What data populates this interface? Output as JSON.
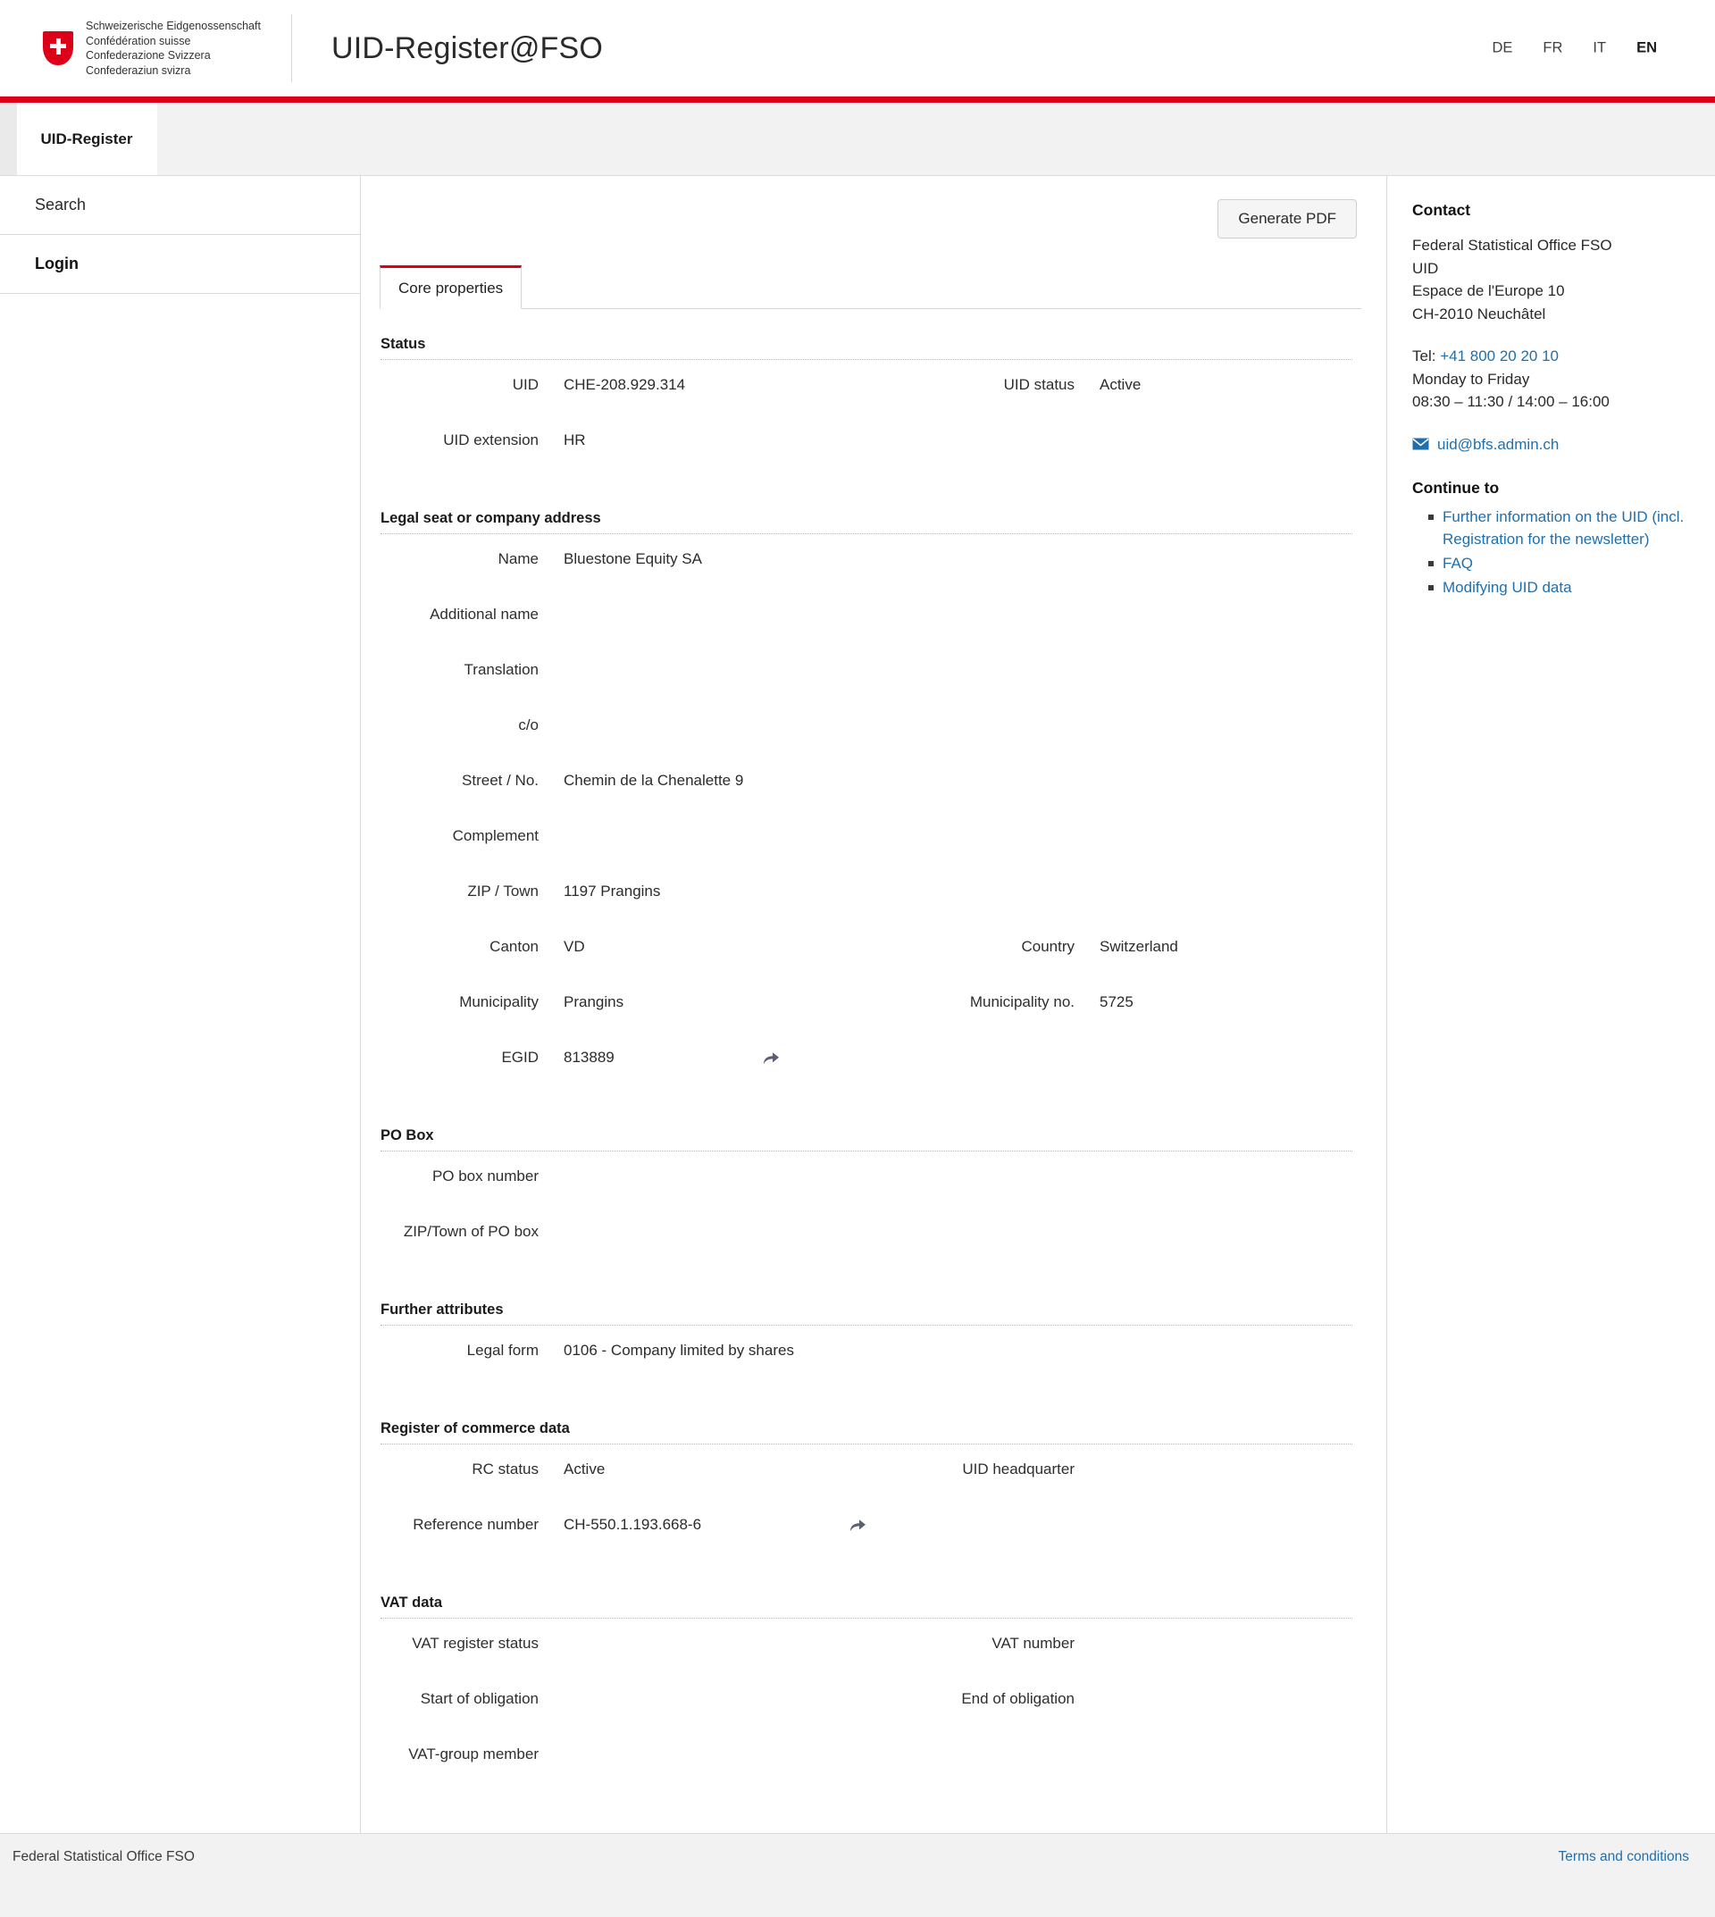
{
  "header": {
    "confederation_lines": [
      "Schweizerische Eidgenossenschaft",
      "Confédération suisse",
      "Confederazione Svizzera",
      "Confederaziun svizra"
    ],
    "app_title": "UID-Register@FSO",
    "languages": [
      {
        "code": "DE",
        "active": false
      },
      {
        "code": "FR",
        "active": false
      },
      {
        "code": "IT",
        "active": false
      },
      {
        "code": "EN",
        "active": true
      }
    ]
  },
  "tabstrip": {
    "main_tab": "UID-Register"
  },
  "sidebar": {
    "items": [
      {
        "label": "Search",
        "bold": false
      },
      {
        "label": "Login",
        "bold": true
      }
    ]
  },
  "main": {
    "generate_pdf_label": "Generate PDF",
    "active_tab": "Core properties",
    "sections": [
      {
        "title": "Status",
        "rows": [
          {
            "left": {
              "label": "UID",
              "value": "CHE-208.929.314"
            },
            "right": {
              "label": "UID status",
              "value": "Active"
            }
          },
          {
            "left": {
              "label": "UID extension",
              "value": "HR"
            },
            "right": {
              "label": "",
              "value": ""
            }
          }
        ]
      },
      {
        "title": "Legal seat or company address",
        "rows": [
          {
            "left": {
              "label": "Name",
              "value": "Bluestone Equity SA"
            },
            "right": {
              "label": "",
              "value": ""
            }
          },
          {
            "left": {
              "label": "Additional name",
              "value": ""
            },
            "right": {
              "label": "",
              "value": ""
            }
          },
          {
            "left": {
              "label": "Translation",
              "value": ""
            },
            "right": {
              "label": "",
              "value": ""
            }
          },
          {
            "left": {
              "label": "c/o",
              "value": ""
            },
            "right": {
              "label": "",
              "value": ""
            }
          },
          {
            "left": {
              "label": "Street / No.",
              "value": "Chemin de la Chenalette 9"
            },
            "right": {
              "label": "",
              "value": ""
            }
          },
          {
            "left": {
              "label": "Complement",
              "value": ""
            },
            "right": {
              "label": "",
              "value": ""
            }
          },
          {
            "left": {
              "label": "ZIP / Town",
              "value": "1197 Prangins"
            },
            "right": {
              "label": "",
              "value": ""
            }
          },
          {
            "left": {
              "label": "Canton",
              "value": "VD"
            },
            "right": {
              "label": "Country",
              "value": "Switzerland"
            }
          },
          {
            "left": {
              "label": "Municipality",
              "value": "Prangins"
            },
            "right": {
              "label": "Municipality no.",
              "value": "5725"
            }
          },
          {
            "left": {
              "label": "EGID",
              "value": "813889",
              "share": true
            },
            "right": {
              "label": "",
              "value": ""
            }
          }
        ]
      },
      {
        "title": "PO Box",
        "rows": [
          {
            "left": {
              "label": "PO box number",
              "value": ""
            },
            "right": {
              "label": "",
              "value": ""
            }
          },
          {
            "left": {
              "label": "ZIP/Town of PO box",
              "value": ""
            },
            "right": {
              "label": "",
              "value": ""
            }
          }
        ]
      },
      {
        "title": "Further attributes",
        "rows": [
          {
            "left": {
              "label": "Legal form",
              "value": "0106 - Company limited by shares"
            },
            "right": {
              "label": "",
              "value": ""
            }
          }
        ]
      },
      {
        "title": "Register of commerce data",
        "rows": [
          {
            "left": {
              "label": "RC status",
              "value": "Active"
            },
            "right": {
              "label": "UID headquarter",
              "value": ""
            }
          },
          {
            "left": {
              "label": "Reference number",
              "value": "CH-550.1.193.668-6",
              "share": true
            },
            "right": {
              "label": "",
              "value": ""
            }
          }
        ]
      },
      {
        "title": "VAT data",
        "rows": [
          {
            "left": {
              "label": "VAT register status",
              "value": ""
            },
            "right": {
              "label": "VAT number",
              "value": ""
            }
          },
          {
            "left": {
              "label": "Start of obligation",
              "value": ""
            },
            "right": {
              "label": "End of obligation",
              "value": ""
            }
          },
          {
            "left": {
              "label": "VAT-group member",
              "value": ""
            },
            "right": {
              "label": "",
              "value": ""
            }
          }
        ]
      }
    ]
  },
  "contact": {
    "title": "Contact",
    "address_lines": [
      "Federal Statistical Office FSO",
      "UID",
      "Espace de l'Europe 10",
      "CH-2010 Neuchâtel"
    ],
    "tel_prefix": "Tel: ",
    "tel_number": "+41 800 20 20 10",
    "hours_days": "Monday to Friday",
    "hours_time": "08:30 – 11:30 / 14:00 – 16:00",
    "email": "uid@bfs.admin.ch",
    "email_icon": "mail-icon",
    "continue_title": "Continue to",
    "continue_links": [
      "Further information on the UID (incl. Registration for the newsletter)",
      "FAQ",
      "Modifying UID data"
    ]
  },
  "footer": {
    "left": "Federal Statistical Office FSO",
    "right_link": "Terms and conditions"
  },
  "colors": {
    "swiss_red": "#dc0018",
    "link_blue": "#1f6fae",
    "tabstrip_bg": "#f2f2f2"
  }
}
